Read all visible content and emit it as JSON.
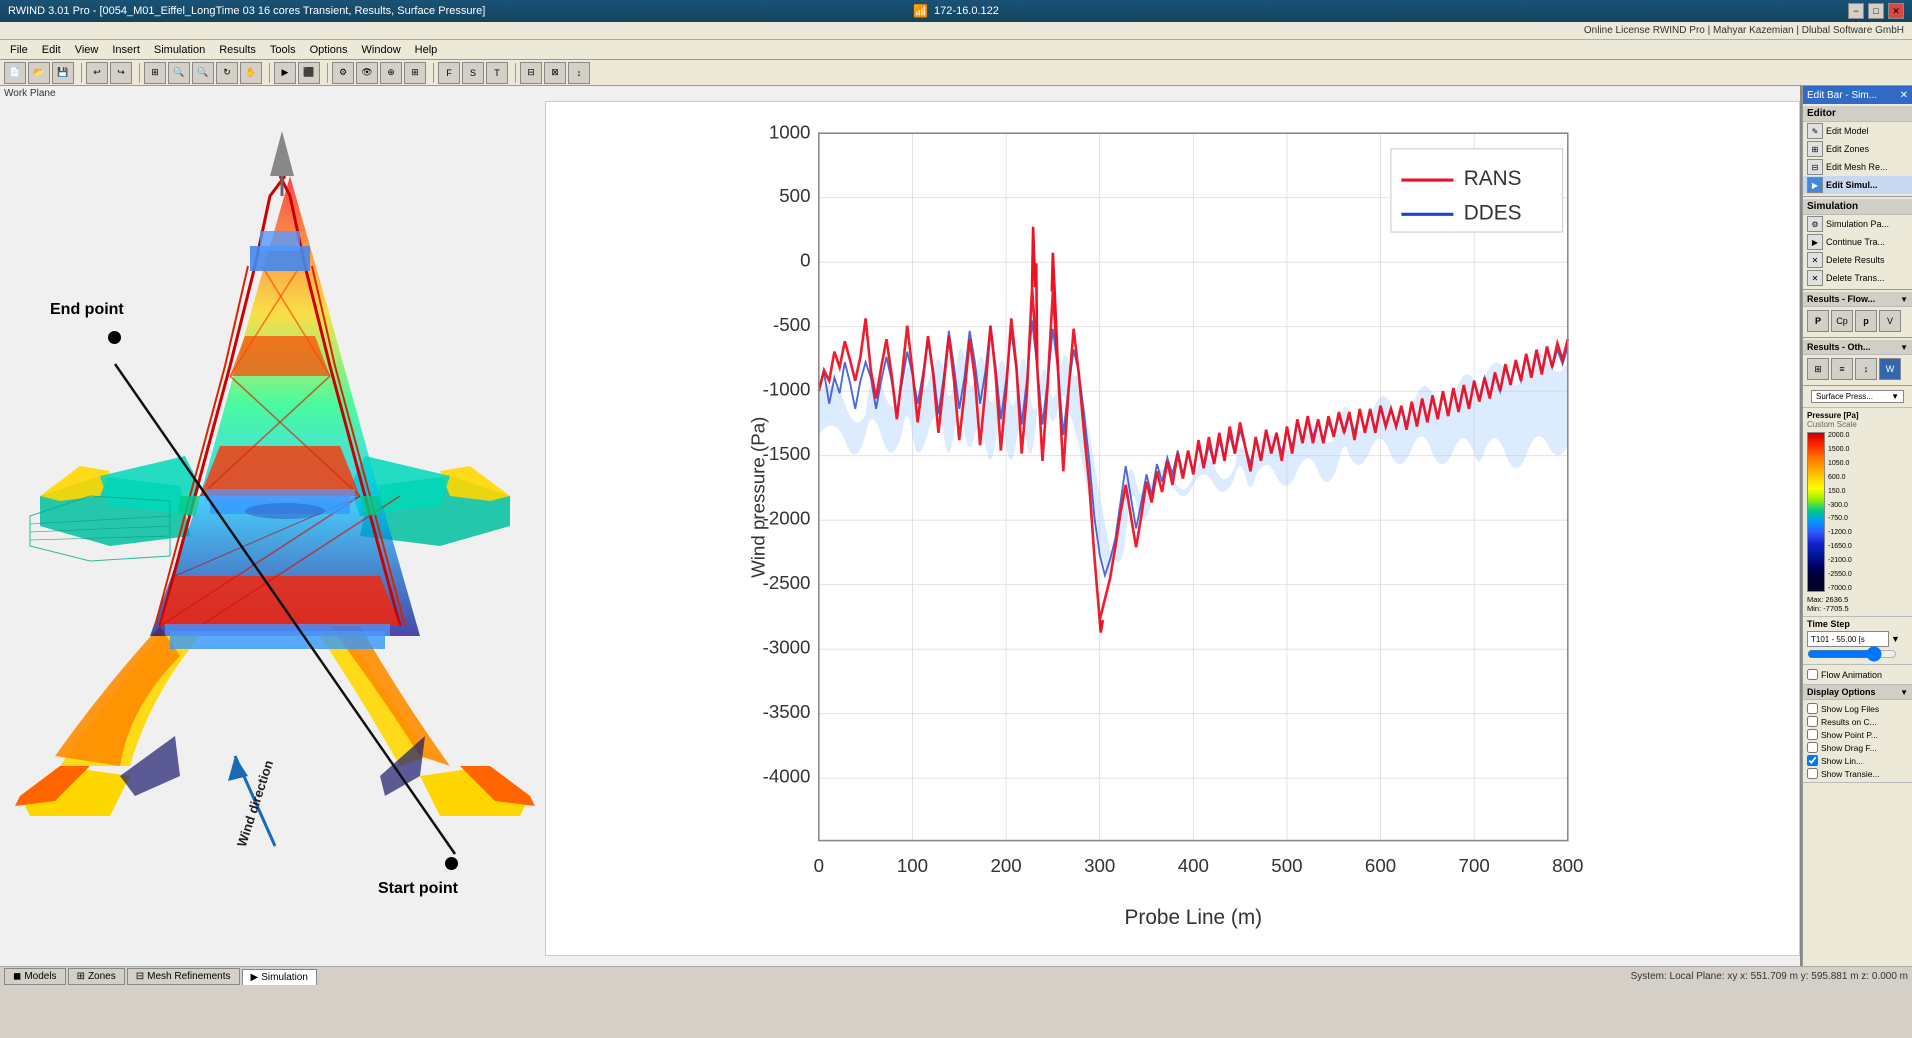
{
  "titleBar": {
    "title": "RWIND 3.01 Pro - [0054_M01_Eiffel_LongTime 03 16 cores Transient, Results, Surface Pressure]",
    "ipLabel": "172-16.0.122",
    "minBtn": "−",
    "maxBtn": "□",
    "closeBtn": "✕"
  },
  "licenseBar": {
    "text": "Online License RWIND Pro | Mahyar Kazemian | Dlubal Software GmbH"
  },
  "menuItems": [
    "File",
    "Edit",
    "View",
    "Insert",
    "Simulation",
    "Results",
    "Tools",
    "Options",
    "Window",
    "Help"
  ],
  "viewport": {
    "labels": {
      "endPoint": "End point",
      "startPoint": "Start point",
      "windDirection": "Wind direction"
    }
  },
  "chart": {
    "title": "",
    "xLabel": "Probe Line (m)",
    "yLabel": "Wind pressure (Pa)",
    "xTicks": [
      "0",
      "100",
      "200",
      "300",
      "400",
      "500",
      "600",
      "700",
      "800"
    ],
    "yTicks": [
      "1000",
      "500",
      "0",
      "-500",
      "-1000",
      "-1500",
      "-2000",
      "-2500",
      "-3000",
      "-3500",
      "-4000"
    ],
    "legend": {
      "rans": "RANS",
      "ddes": "DDES"
    }
  },
  "rightPanel": {
    "header": "Edit Bar - Sim...",
    "editorSection": {
      "title": "Editor",
      "items": [
        {
          "icon": "✎",
          "label": "Edit Model"
        },
        {
          "icon": "⊞",
          "label": "Edit Zones"
        },
        {
          "icon": "⊟",
          "label": "Edit Mesh Re..."
        },
        {
          "icon": "▶",
          "label": "Edit Simul..."
        }
      ]
    },
    "simulationSection": {
      "title": "Simulation",
      "items": [
        {
          "icon": "⚙",
          "label": "Simulation Pa..."
        },
        {
          "icon": "▶",
          "label": "Continue Tra..."
        },
        {
          "icon": "✕",
          "label": "Delete Results"
        },
        {
          "icon": "✕",
          "label": "Delete Trans..."
        }
      ]
    },
    "resultsFlowSection": {
      "title": "Results - Flow...",
      "buttons": [
        "P",
        "Cp",
        "P",
        "V"
      ]
    },
    "resultsOtherSection": {
      "title": "Results - Oth...",
      "buttons": [
        "icon1",
        "icon2",
        "icon3",
        "W"
      ]
    },
    "surfacePressSection": {
      "label": "Surface Press...",
      "dropdown": true
    },
    "colorScale": {
      "title": "Pressure [Pa]",
      "subtitle": "Custom Scale",
      "values": [
        "2000.0",
        "1500.0",
        "1050.0",
        "600.0",
        "150.0",
        "-300.0",
        "-750.0",
        "-1200.0",
        "-1650.0",
        "-2100.0",
        "-2550.0",
        "-7000.0"
      ],
      "maxLabel": "Max:",
      "maxValue": "2636.5",
      "minLabel": "Min:",
      "minValue": "-7705.5"
    },
    "timeStep": {
      "title": "Time Step",
      "value": "T101 - 55.00 [s"
    },
    "flowAnimation": {
      "label": "Flow Animation",
      "checked": false
    },
    "displayOptions": {
      "label": "Display Options"
    },
    "checkboxes": [
      {
        "label": "Show Log Files",
        "checked": false
      },
      {
        "label": "Results on C...",
        "checked": false
      },
      {
        "label": "Show Point P...",
        "checked": false
      },
      {
        "label": "Show Drag F...",
        "checked": false
      },
      {
        "label": "Show Lin...",
        "checked": true
      },
      {
        "label": "Show Transie...",
        "checked": false
      }
    ]
  },
  "statusBar": {
    "tabs": [
      "Models",
      "Zones",
      "Mesh Refinements",
      "Simulation"
    ],
    "activeTab": 3,
    "info": "System: Local    Plane: xy    x: 551.709 m    y: 595.881 m    z: 0.000 m"
  },
  "workPlane": "Work Plane"
}
